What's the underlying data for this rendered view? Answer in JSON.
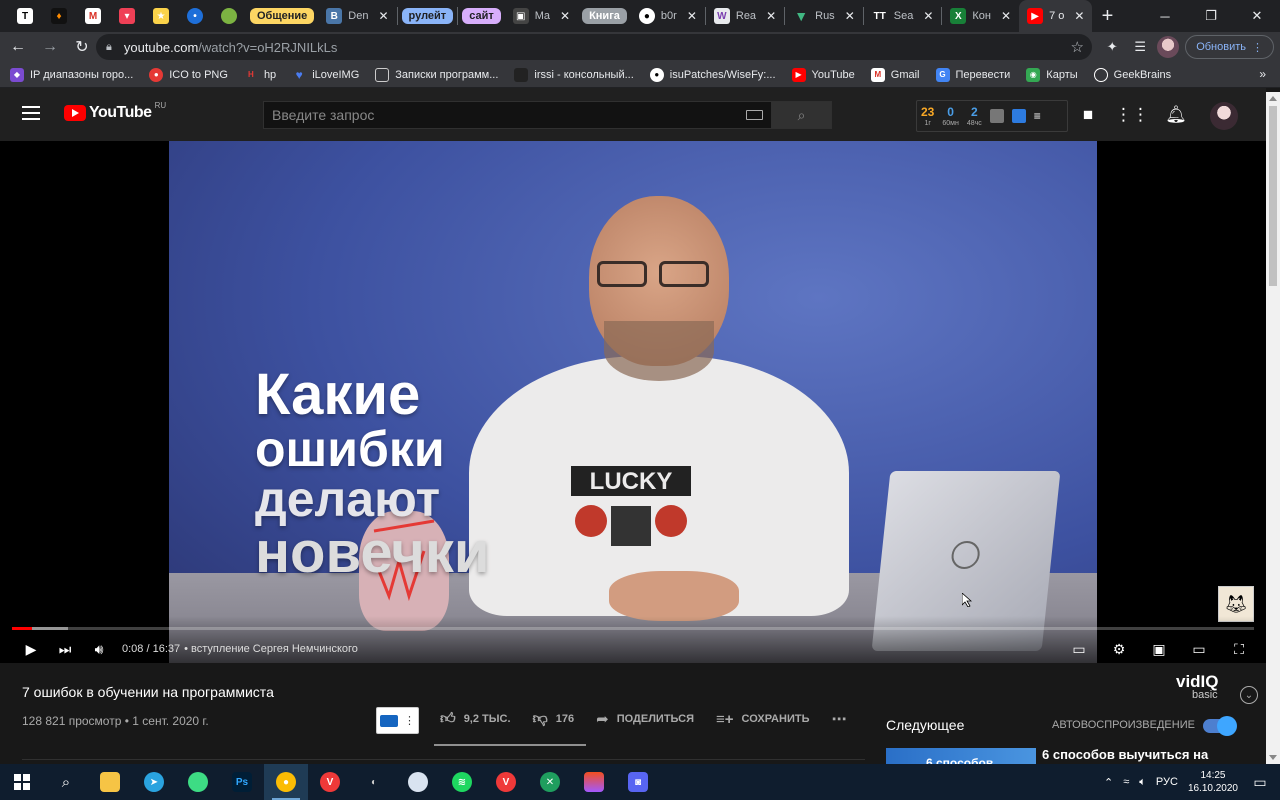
{
  "browser": {
    "group_labels": [
      "Общение",
      "рулейт",
      "сайт",
      "Книга"
    ],
    "tabs": [
      {
        "label": "Den",
        "icon": "vk-icon"
      },
      {
        "label": "Ma",
        "icon": "mail-icon"
      },
      {
        "label": "b0r",
        "icon": "github-icon"
      },
      {
        "label": "Rea",
        "icon": "read-icon"
      },
      {
        "label": "Rus",
        "icon": "vue-icon"
      },
      {
        "label": "Sea",
        "icon": "search-tab-icon"
      },
      {
        "label": "Кон",
        "icon": "excel-icon"
      },
      {
        "label": "7 о",
        "icon": "youtube-icon"
      }
    ],
    "url_domain": "youtube.com",
    "url_path": "/watch?v=oH2RJNILkLs",
    "update_label": "Обновить",
    "bookmarks": [
      "IP диапазоны горо...",
      "ICO to PNG",
      "hp",
      "iLoveIMG",
      "Записки программ...",
      "irssi - консольный...",
      "isuPatches/WiseFy:...",
      "YouTube",
      "Gmail",
      "Перевести",
      "Карты",
      "GeekBrains"
    ]
  },
  "youtube": {
    "logo_text": "YouTube",
    "region": "RU",
    "search_placeholder": "Введите запрос",
    "stats": [
      {
        "value": "23",
        "label": "1г",
        "color": "#f9a825"
      },
      {
        "value": "0",
        "label": "60мн",
        "color": "#4a9ee8"
      },
      {
        "value": "2",
        "label": "48чс",
        "color": "#4a9ee8"
      }
    ],
    "overlay": {
      "line1": "Какие",
      "line2": "ошибки",
      "line3": "делают",
      "line4": "новечки"
    },
    "player": {
      "time": "0:08 / 16:37",
      "chapter": "• вступление Сергея Немчинского",
      "progress_played": 0.016,
      "progress_buffered": 0.045
    },
    "video": {
      "title": "7 ошибок в обучении на программиста",
      "meta": "128 821 просмотр • 1 сент. 2020 г.",
      "likes": "9,2 ТЫС.",
      "dislikes": "176",
      "share": "ПОДЕЛИТЬСЯ",
      "save": "СОХРАНИТЬ"
    },
    "vidiq": {
      "name": "vidIQ",
      "tier": "basic"
    },
    "upnext": {
      "heading": "Следующее",
      "autoplay": "АВТОВОСПРОИЗВЕДЕНИЕ",
      "thumb_text": "6 способов",
      "next_title": "6 способов выучиться на"
    }
  },
  "taskbar": {
    "lang": "РУС",
    "time": "14:25",
    "date": "16.10.2020"
  }
}
